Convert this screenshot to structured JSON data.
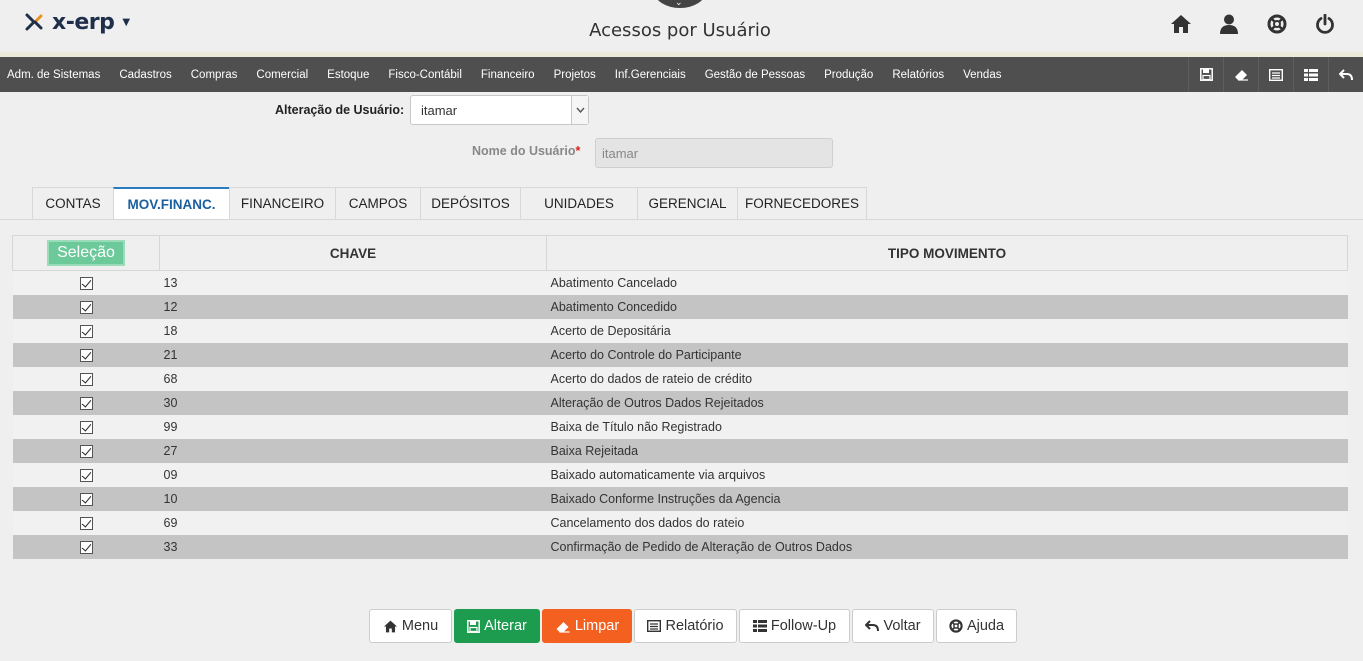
{
  "app": {
    "logo_text": "x-erp",
    "title": "Acessos por Usuário"
  },
  "top_icons": [
    "home-icon",
    "user-icon",
    "lifebuoy-icon",
    "power-icon"
  ],
  "menu": {
    "items": [
      "Adm. de Sistemas",
      "Cadastros",
      "Compras",
      "Comercial",
      "Estoque",
      "Fisco-Contábil",
      "Financeiro",
      "Projetos",
      "Inf.Gerenciais",
      "Gestão de Pessoas",
      "Produção",
      "Relatórios",
      "Vendas"
    ],
    "tools": [
      "save-icon",
      "eraser-icon",
      "report-icon",
      "grid-icon",
      "back-icon"
    ]
  },
  "form": {
    "alteracao_label": "Alteração de Usuário:",
    "alteracao_value": "itamar",
    "nome_label": "Nome do Usuário",
    "nome_required": "*",
    "nome_value": "itamar"
  },
  "tabs": [
    {
      "label": "CONTAS",
      "active": false
    },
    {
      "label": "MOV.FINANC.",
      "active": true
    },
    {
      "label": "FINANCEIRO",
      "active": false
    },
    {
      "label": "CAMPOS",
      "active": false
    },
    {
      "label": "DEPÓSITOS",
      "active": false
    },
    {
      "label": "UNIDADES",
      "active": false
    },
    {
      "label": "GERENCIAL",
      "active": false
    },
    {
      "label": "FORNECEDORES",
      "active": false
    }
  ],
  "table": {
    "select_label": "Seleção",
    "columns": [
      "CHAVE",
      "TIPO MOVIMENTO"
    ],
    "rows": [
      {
        "checked": true,
        "chave": "13",
        "tipo": "Abatimento Cancelado"
      },
      {
        "checked": true,
        "chave": "12",
        "tipo": "Abatimento Concedido"
      },
      {
        "checked": true,
        "chave": "18",
        "tipo": "Acerto de Depositária"
      },
      {
        "checked": true,
        "chave": "21",
        "tipo": "Acerto do Controle do Participante"
      },
      {
        "checked": true,
        "chave": "68",
        "tipo": "Acerto do dados de rateio de crédito"
      },
      {
        "checked": true,
        "chave": "30",
        "tipo": "Alteração de Outros Dados Rejeitados"
      },
      {
        "checked": true,
        "chave": "99",
        "tipo": "Baixa de Título não Registrado"
      },
      {
        "checked": true,
        "chave": "27",
        "tipo": "Baixa Rejeitada"
      },
      {
        "checked": true,
        "chave": "09",
        "tipo": "Baixado automaticamente via arquivos"
      },
      {
        "checked": true,
        "chave": "10",
        "tipo": "Baixado Conforme Instruções da Agencia"
      },
      {
        "checked": true,
        "chave": "69",
        "tipo": "Cancelamento dos dados do rateio"
      },
      {
        "checked": true,
        "chave": "33",
        "tipo": "Confirmação de Pedido de Alteração de Outros Dados"
      }
    ]
  },
  "buttons": {
    "menu": "Menu",
    "alterar": "Alterar",
    "limpar": "Limpar",
    "relatorio": "Relatório",
    "followup": "Follow-Up",
    "voltar": "Voltar",
    "ajuda": "Ajuda"
  },
  "colors": {
    "menubar": "#4f4f4f",
    "green": "#1d9c50",
    "orange": "#f4601f",
    "tab_active": "#1a5fa0"
  }
}
